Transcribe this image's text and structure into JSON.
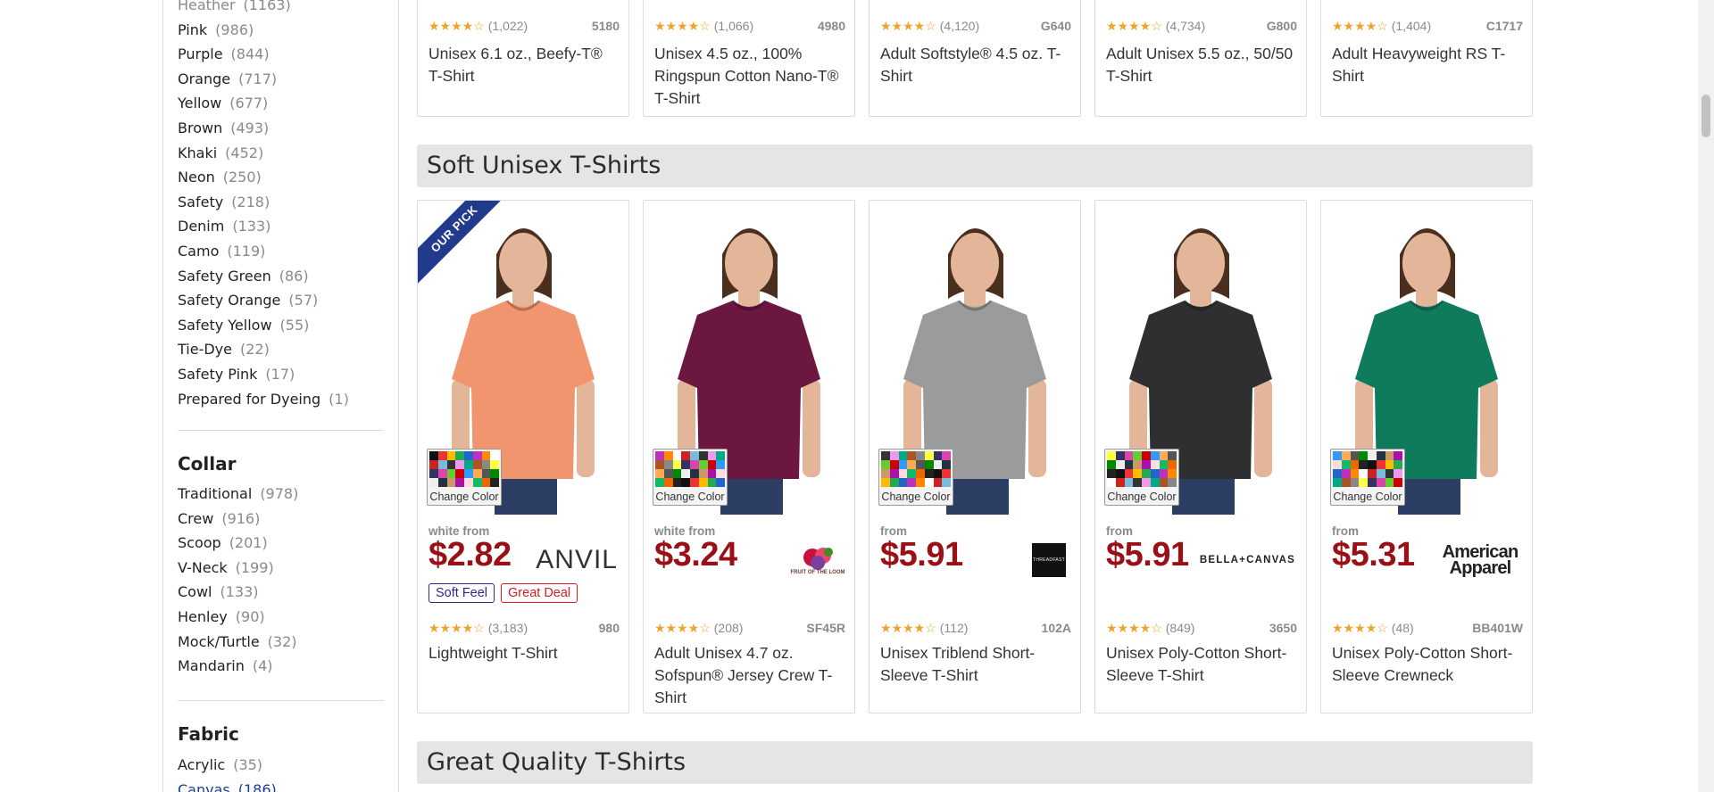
{
  "sidebar": {
    "color_items": [
      {
        "label": "Heather",
        "count": "(1163)",
        "muted": true
      },
      {
        "label": "Pink",
        "count": "(986)"
      },
      {
        "label": "Purple",
        "count": "(844)"
      },
      {
        "label": "Orange",
        "count": "(717)"
      },
      {
        "label": "Yellow",
        "count": "(677)"
      },
      {
        "label": "Brown",
        "count": "(493)"
      },
      {
        "label": "Khaki",
        "count": "(452)"
      },
      {
        "label": "Neon",
        "count": "(250)"
      },
      {
        "label": "Safety",
        "count": "(218)"
      },
      {
        "label": "Denim",
        "count": "(133)"
      },
      {
        "label": "Camo",
        "count": "(119)"
      },
      {
        "label": "Safety Green",
        "count": "(86)"
      },
      {
        "label": "Safety Orange",
        "count": "(57)"
      },
      {
        "label": "Safety Yellow",
        "count": "(55)"
      },
      {
        "label": "Tie-Dye",
        "count": "(22)"
      },
      {
        "label": "Safety Pink",
        "count": "(17)"
      },
      {
        "label": "Prepared for Dyeing",
        "count": "(1)"
      }
    ],
    "collar": {
      "title": "Collar",
      "items": [
        {
          "label": "Traditional",
          "count": "(978)"
        },
        {
          "label": "Crew",
          "count": "(916)"
        },
        {
          "label": "Scoop",
          "count": "(201)"
        },
        {
          "label": "V-Neck",
          "count": "(199)"
        },
        {
          "label": "Cowl",
          "count": "(133)"
        },
        {
          "label": "Henley",
          "count": "(90)"
        },
        {
          "label": "Mock/Turtle",
          "count": "(32)"
        },
        {
          "label": "Mandarin",
          "count": "(4)"
        }
      ]
    },
    "fabric": {
      "title": "Fabric",
      "items": [
        {
          "label": "Acrylic",
          "count": "(35)"
        },
        {
          "label": "Canvas",
          "count": "(186)",
          "link": true
        }
      ]
    }
  },
  "top_row": [
    {
      "reviews": "(1,022)",
      "sku": "5180",
      "title": "Unisex 6.1 oz., Beefy-T® T-Shirt"
    },
    {
      "reviews": "(1,066)",
      "sku": "4980",
      "title": "Unisex 4.5 oz., 100% Ringspun Cotton Nano-T® T-Shirt"
    },
    {
      "reviews": "(4,120)",
      "sku": "G640",
      "title": "Adult Softstyle® 4.5 oz. T-Shirt"
    },
    {
      "reviews": "(4,734)",
      "sku": "G800",
      "title": "Adult Unisex 5.5 oz., 50/50 T-Shirt"
    },
    {
      "reviews": "(1,404)",
      "sku": "C1717",
      "title": "Adult Heavyweight RS T-Shirt"
    }
  ],
  "section1": {
    "title": "Soft Unisex T-Shirts"
  },
  "section2": {
    "title": "Great Quality T-Shirts"
  },
  "change_color_label": "Change Color",
  "ribbon_label": "OUR PICK",
  "products": [
    {
      "from": "white from",
      "price": "$2.82",
      "brand": "ANVIL",
      "badges": [
        "Soft Feel",
        "Great Deal"
      ],
      "reviews": "(3,183)",
      "sku": "980",
      "title": "Lightweight T-Shirt",
      "shirt_color": "#f0956e",
      "pick": true
    },
    {
      "from": "white from",
      "price": "$3.24",
      "brand": "FRUIT OF THE LOOM",
      "badges": [],
      "reviews": "(208)",
      "sku": "SF45R",
      "title": "Adult Unisex 4.7 oz. Sofspun® Jersey Crew T-Shirt",
      "shirt_color": "#6b1740",
      "pick": false
    },
    {
      "from": "from",
      "price": "$5.91",
      "brand": "THREADFAST",
      "badges": [],
      "reviews": "(112)",
      "sku": "102A",
      "title": "Unisex Triblend Short-Sleeve T-Shirt",
      "shirt_color": "#9b9b9b",
      "pick": false
    },
    {
      "from": "from",
      "price": "$5.91",
      "brand": "BELLA+CANVAS",
      "badges": [],
      "reviews": "(849)",
      "sku": "3650",
      "title": "Unisex Poly-Cotton Short-Sleeve T-Shirt",
      "shirt_color": "#2e2f31",
      "pick": false
    },
    {
      "from": "from",
      "price": "$5.31",
      "brand": "American Apparel",
      "badges": [],
      "reviews": "(48)",
      "sku": "BB401W",
      "title": "Unisex Poly-Cotton Short-Sleeve Crewneck",
      "shirt_color": "#0f7b5d",
      "pick": false
    }
  ],
  "stars": "★★★★☆"
}
